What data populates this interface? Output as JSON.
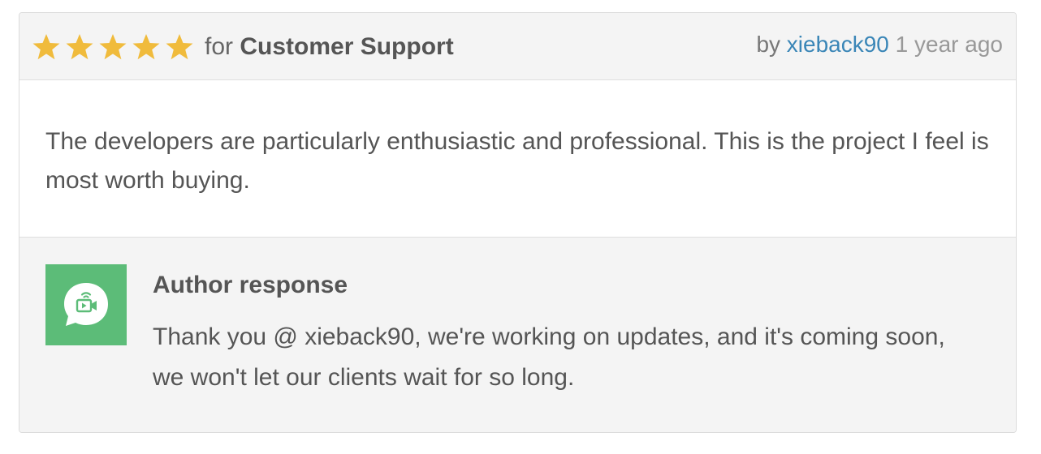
{
  "review": {
    "rating": 5,
    "rating_max": 5,
    "star_color": "#f0bb3c",
    "for_prefix": "for",
    "category": "Customer Support",
    "by_prefix": "by",
    "author": "xieback90",
    "author_link_color": "#3a86b7",
    "time": "1 year ago",
    "body": "The developers are particularly enthusiastic and professional. This is the project I feel is most worth buying."
  },
  "response": {
    "avatar_icon": "video-chat-bubble-icon",
    "avatar_color": "#5cbc78",
    "title": "Author response",
    "text": "Thank you @ xieback90, we're working on updates, and it's coming soon, we won't let our clients wait for so long."
  }
}
